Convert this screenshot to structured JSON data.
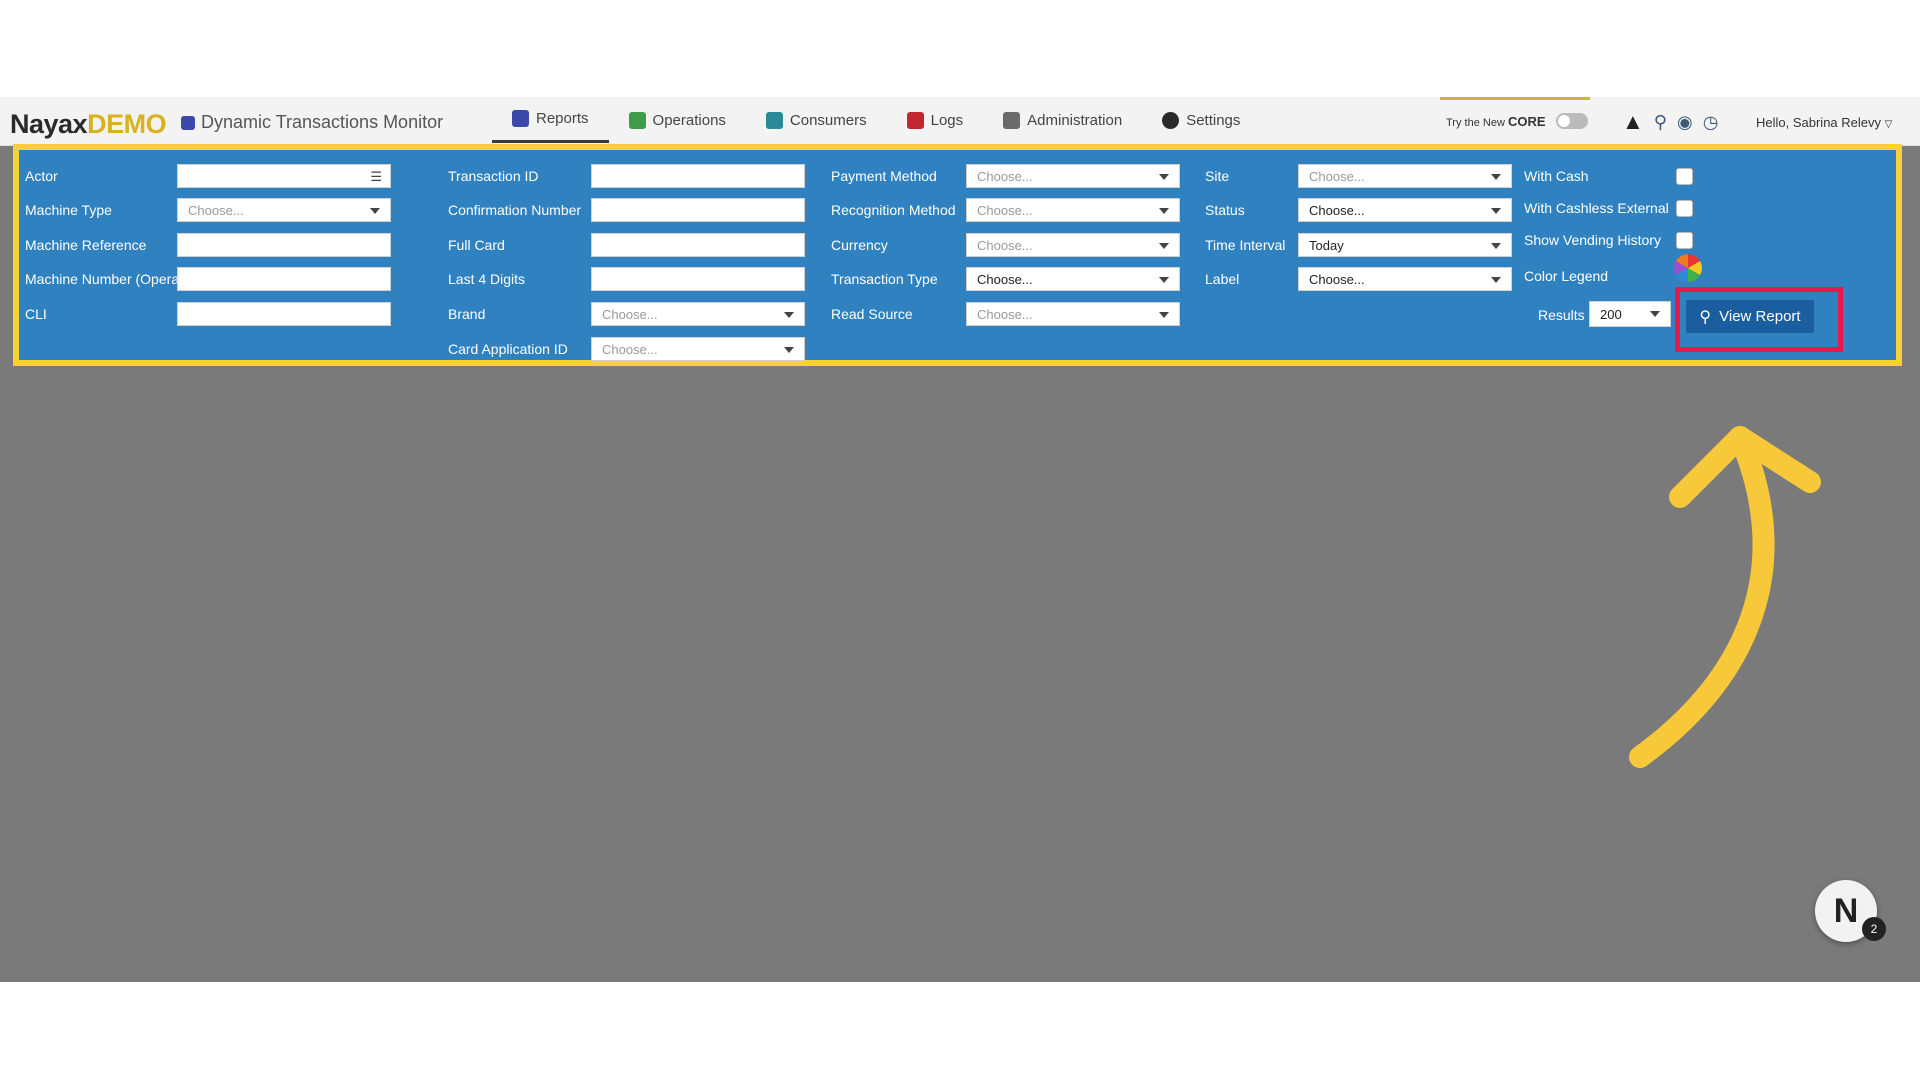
{
  "header": {
    "logo_main": "Nayax",
    "logo_suffix": "DEMO",
    "page_title": "Dynamic Transactions Monitor",
    "nav": [
      {
        "label": "Reports",
        "color": "#3b4aa8",
        "active": true
      },
      {
        "label": "Operations",
        "color": "#3f9a4c",
        "active": false
      },
      {
        "label": "Consumers",
        "color": "#2b8a9a",
        "active": false
      },
      {
        "label": "Logs",
        "color": "#c2262e",
        "active": false
      },
      {
        "label": "Administration",
        "color": "#6b6b6b",
        "active": false
      },
      {
        "label": "Settings",
        "color": "#2a2a2a",
        "active": false
      }
    ],
    "try_core_prefix": "Try the New",
    "try_core_brand": "CORE",
    "greeting": "Hello, Sabrina Relevy"
  },
  "filters": {
    "col1": {
      "actor": {
        "label": "Actor",
        "value": ""
      },
      "machine_type": {
        "label": "Machine Type",
        "value": "Choose..."
      },
      "machine_reference": {
        "label": "Machine Reference",
        "value": ""
      },
      "machine_number": {
        "label": "Machine Number (Operator)",
        "value": ""
      },
      "cli": {
        "label": "CLI",
        "value": ""
      }
    },
    "col2": {
      "transaction_id": {
        "label": "Transaction ID",
        "value": ""
      },
      "confirmation_number": {
        "label": "Confirmation Number",
        "value": ""
      },
      "full_card": {
        "label": "Full Card",
        "value": ""
      },
      "last4": {
        "label": "Last 4 Digits",
        "value": ""
      },
      "brand": {
        "label": "Brand",
        "value": "Choose..."
      },
      "card_app_id": {
        "label": "Card Application ID",
        "value": "Choose..."
      }
    },
    "col3": {
      "payment_method": {
        "label": "Payment Method",
        "value": "Choose..."
      },
      "recognition_method": {
        "label": "Recognition Method",
        "value": "Choose..."
      },
      "currency": {
        "label": "Currency",
        "value": "Choose..."
      },
      "transaction_type": {
        "label": "Transaction Type",
        "value": "Choose..."
      },
      "read_source": {
        "label": "Read Source",
        "value": "Choose..."
      }
    },
    "col4": {
      "site": {
        "label": "Site",
        "value": "Choose..."
      },
      "status": {
        "label": "Status",
        "value": "Choose..."
      },
      "time_interval": {
        "label": "Time Interval",
        "value": "Today"
      },
      "label": {
        "label": "Label",
        "value": "Choose..."
      }
    },
    "col5": {
      "with_cash": {
        "label": "With Cash",
        "checked": false
      },
      "with_cashless_external": {
        "label": "With Cashless External",
        "checked": false
      },
      "show_vending_history": {
        "label": "Show Vending History",
        "checked": false
      },
      "color_legend": {
        "label": "Color Legend"
      },
      "results": {
        "label": "Results",
        "value": "200"
      }
    },
    "view_report_label": "View Report"
  },
  "fab": {
    "letter": "N",
    "badge": "2"
  }
}
